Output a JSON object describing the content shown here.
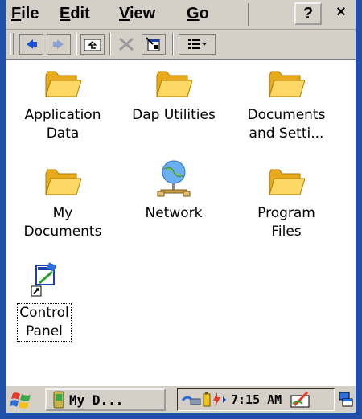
{
  "menubar": {
    "items": [
      {
        "label_u": "F",
        "label_rest": "ile"
      },
      {
        "label_u": "E",
        "label_rest": "dit"
      },
      {
        "label_u": "V",
        "label_rest": "iew"
      },
      {
        "label_u": "G",
        "label_rest": "o"
      }
    ],
    "help_label": "?",
    "close_label": "×"
  },
  "toolbar": {
    "buttons": [
      "back-icon",
      "forward-icon",
      "up-folder-icon",
      "delete-icon",
      "properties-icon",
      "view-options-icon"
    ],
    "view_dropdown_glyph": "▾"
  },
  "items": [
    {
      "name": "Application Data",
      "line1": "Application",
      "line2": "Data",
      "icon": "folder-icon"
    },
    {
      "name": "Dap Utilities",
      "line1": "Dap Utilities",
      "line2": "",
      "icon": "folder-icon"
    },
    {
      "name": "Documents and Settings",
      "line1": "Documents",
      "line2": "and Setti...",
      "icon": "folder-icon"
    },
    {
      "name": "My Documents",
      "line1": "My",
      "line2": "Documents",
      "icon": "folder-icon"
    },
    {
      "name": "Network",
      "line1": "Network",
      "line2": "",
      "icon": "network-icon"
    },
    {
      "name": "Program Files",
      "line1": "Program",
      "line2": "Files",
      "icon": "folder-icon"
    },
    {
      "name": "Control Panel",
      "line1": "Control",
      "line2": "Panel",
      "icon": "control-panel-shortcut-icon"
    }
  ],
  "taskbar": {
    "task_label": "My D...",
    "clock": "7:15 AM"
  },
  "colors": {
    "frame": "#1f4fa6",
    "chrome": "#d4d0c8",
    "folder": "#f7c642"
  }
}
